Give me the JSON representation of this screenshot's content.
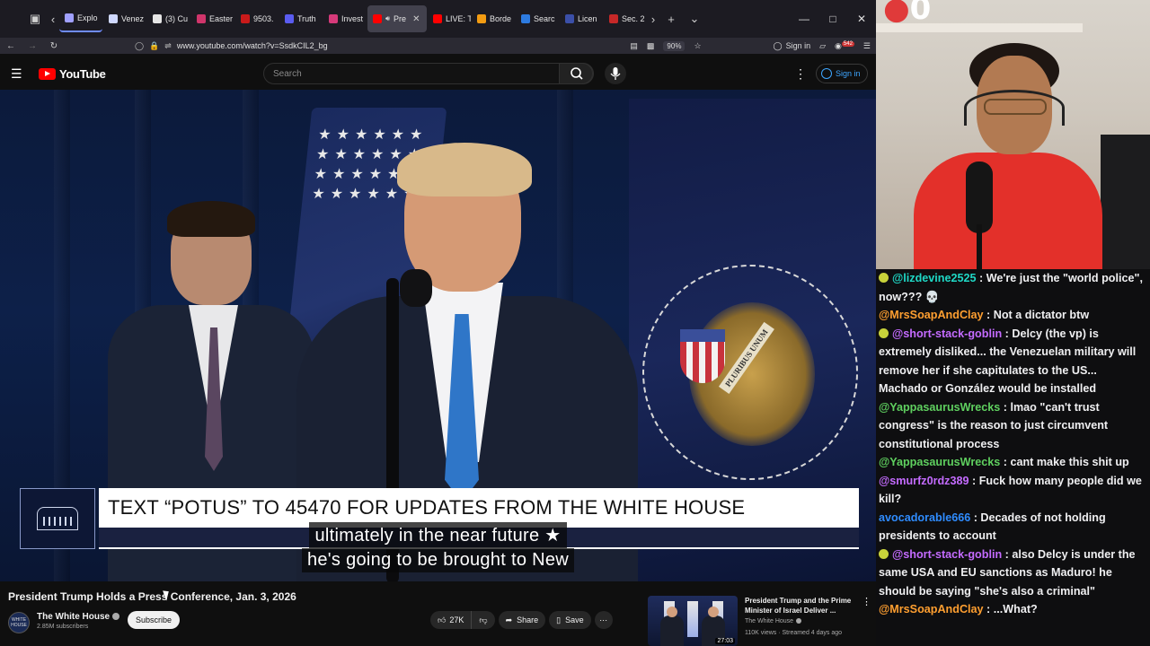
{
  "browser": {
    "tabs": [
      {
        "label": "Explo",
        "color": "#a0a0ff",
        "active": false,
        "first": true
      },
      {
        "label": "Venez",
        "color": "#cfd8ff",
        "active": false
      },
      {
        "label": "(3) Cu",
        "color": "#e6e6e6",
        "active": false
      },
      {
        "label": "Easter",
        "color": "#d0356b",
        "active": false
      },
      {
        "label": "9503.",
        "color": "#c91a1a",
        "active": false
      },
      {
        "label": "Truth",
        "color": "#5a5cf0",
        "active": false
      },
      {
        "label": "Invest",
        "color": "#d63a7a",
        "active": false
      },
      {
        "label": "Pre",
        "color": "#ff0000",
        "active": true
      },
      {
        "label": "LIVE: T",
        "color": "#ff0000",
        "active": false
      },
      {
        "label": "Borde",
        "color": "#f39c12",
        "active": false
      },
      {
        "label": "Searc",
        "color": "#2d7be0",
        "active": false
      },
      {
        "label": "Licen",
        "color": "#3b4fa8",
        "active": false
      },
      {
        "label": "Sec. 2",
        "color": "#c62828",
        "active": false
      }
    ],
    "url": "www.youtube.com/watch?v=SsdkCIL2_bg",
    "zoom": "90%",
    "signin_label": "Sign in",
    "ext_badge": "542"
  },
  "youtube": {
    "logo_text": "YouTube",
    "search_placeholder": "Search",
    "signin_label": "Sign in",
    "video": {
      "lower_third_text": "TEXT “POTUS” TO 45470 FOR UPDATES FROM THE WHITE HOUSE",
      "caption_line1": "ultimately in the near future ★",
      "caption_line2": "he's going to be brought to New",
      "seal_banner": "PLURIBUS UNUM"
    },
    "title": "President Trump Holds a Press Conference, Jan. 3, 2026",
    "channel": {
      "name": "The White House",
      "subscribers": "2.85M subscribers",
      "avatar_text": "WHITE HOUSE"
    },
    "subscribe_label": "Subscribe",
    "actions": {
      "like_count": "27K",
      "share_label": "Share",
      "save_label": "Save"
    },
    "recommendation": {
      "title": "President Trump and the Prime Minister of Israel Deliver ...",
      "channel": "The White House",
      "meta": "110K views · Streamed 4 days ago",
      "duration": "27:03"
    }
  },
  "stream": {
    "counter": "0",
    "chat": [
      {
        "user": "@lizdevine2525",
        "color": "#1fd8c6",
        "bullet": true,
        "text": "We're just the \"world police\", now??? 💀"
      },
      {
        "user": "@MrsSoapAndClay",
        "color": "#ff9f30",
        "bullet": false,
        "text": "Not a dictator btw"
      },
      {
        "user": "@short-stack-goblin",
        "color": "#c46bff",
        "bullet": true,
        "text": "Delcy (the vp) is extremely disliked... the Venezuelan military will remove her if she capitulates to the US... Machado or González would be installed"
      },
      {
        "user": "@YappasaurusWrecks",
        "color": "#5fd05f",
        "bullet": false,
        "text": "lmao \"can't trust congress\" is the reason to just circumvent constitutional process"
      },
      {
        "user": "@YappasaurusWrecks",
        "color": "#5fd05f",
        "bullet": false,
        "text": "cant make this shit up"
      },
      {
        "user": "@smurfz0rdz389",
        "color": "#c46bff",
        "bullet": false,
        "text": "Fuck how many people did we kill?"
      },
      {
        "user": "avocadorable666",
        "color": "#2f8cff",
        "bullet": false,
        "text": "Decades of not holding presidents to account"
      },
      {
        "user": "@short-stack-goblin",
        "color": "#c46bff",
        "bullet": true,
        "text": "also Delcy is under the same USA and EU sanctions as Maduro! he should be saying \"she's also a criminal\""
      },
      {
        "user": "@MrsSoapAndClay",
        "color": "#ff9f30",
        "bullet": false,
        "text": "...What?"
      }
    ]
  }
}
